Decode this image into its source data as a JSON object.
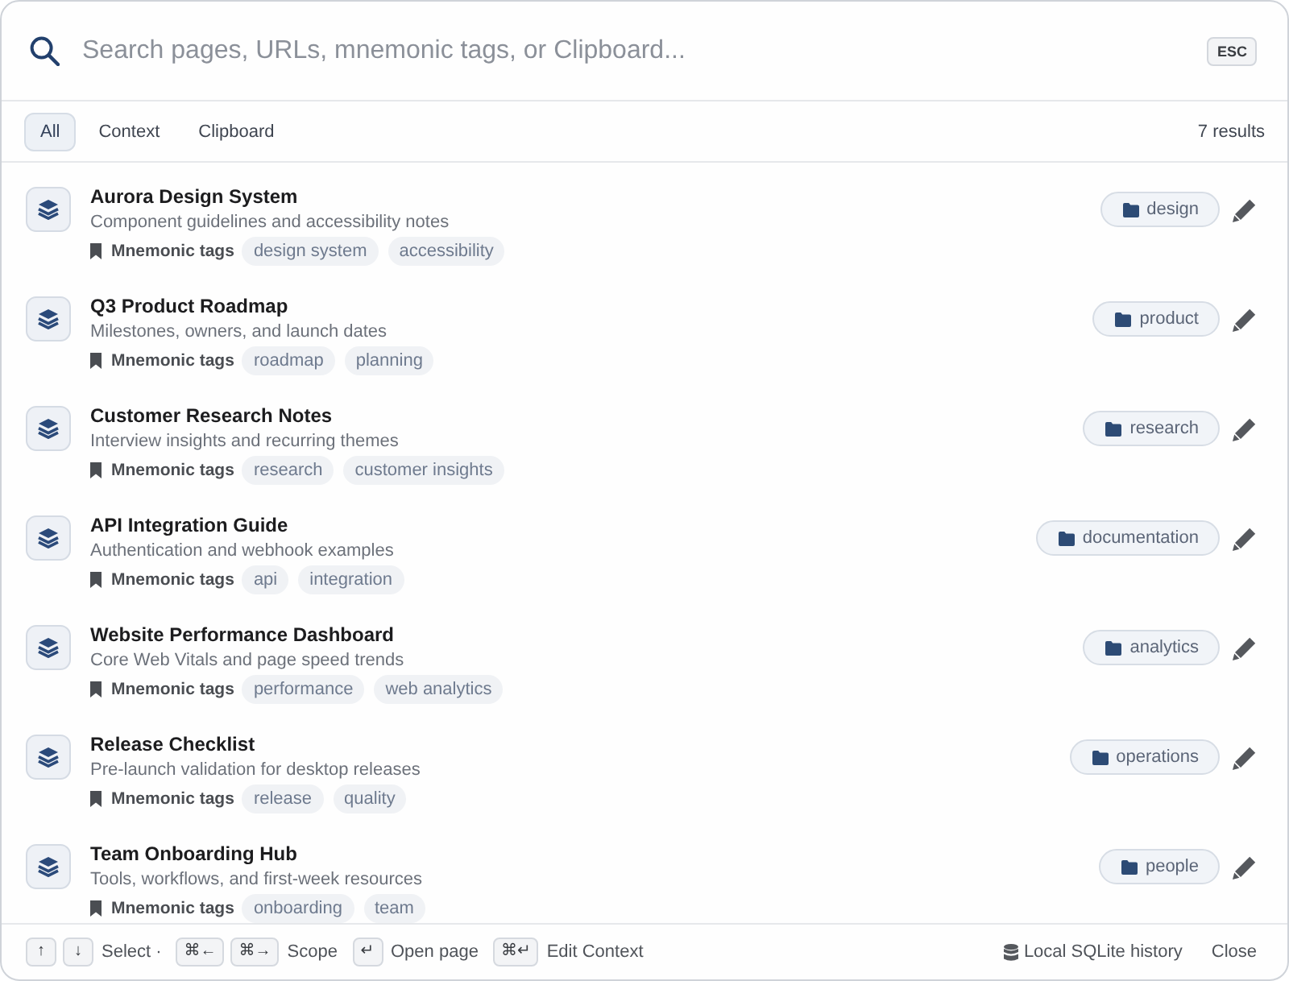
{
  "search": {
    "placeholder": "Search pages, URLs, mnemonic tags, or Clipboard...",
    "shortcut": "ESC"
  },
  "filters": [
    {
      "label": "All",
      "selected": true
    },
    {
      "label": "Context",
      "selected": false
    },
    {
      "label": "Clipboard",
      "selected": false
    }
  ],
  "result_count": "7 results",
  "results": [
    {
      "title": "Aurora Design System",
      "description": "Component guidelines and accessibility notes",
      "tags_label": "Mnemonic tags",
      "tags": [
        "design system",
        "accessibility"
      ],
      "folder": "design"
    },
    {
      "title": "Q3 Product Roadmap",
      "description": "Milestones, owners, and launch dates",
      "tags_label": "Mnemonic tags",
      "tags": [
        "roadmap",
        "planning"
      ],
      "folder": "product"
    },
    {
      "title": "Customer Research Notes",
      "description": "Interview insights and recurring themes",
      "tags_label": "Mnemonic tags",
      "tags": [
        "research",
        "customer insights"
      ],
      "folder": "research"
    },
    {
      "title": "API Integration Guide",
      "description": "Authentication and webhook examples",
      "tags_label": "Mnemonic tags",
      "tags": [
        "api",
        "integration"
      ],
      "folder": "documentation"
    },
    {
      "title": "Website Performance Dashboard",
      "description": "Core Web Vitals and page speed trends",
      "tags_label": "Mnemonic tags",
      "tags": [
        "performance",
        "web analytics"
      ],
      "folder": "analytics"
    },
    {
      "title": "Release Checklist",
      "description": "Pre-launch validation for desktop releases",
      "tags_label": "Mnemonic tags",
      "tags": [
        "release",
        "quality"
      ],
      "folder": "operations"
    },
    {
      "title": "Team Onboarding Hub",
      "description": "Tools, workflows, and first-week resources",
      "tags_label": "Mnemonic tags",
      "tags": [
        "onboarding",
        "team"
      ],
      "folder": "people"
    }
  ],
  "footer": {
    "hints": [
      {
        "keys": [
          "↑",
          "↓"
        ],
        "label": "Select ·"
      },
      {
        "keys": [
          "⌘←",
          "⌘→"
        ],
        "label": "Scope"
      },
      {
        "keys": [
          "↵"
        ],
        "label": "Open page"
      },
      {
        "keys": [
          "⌘↵"
        ],
        "label": "Edit Context"
      }
    ],
    "source": "Local SQLite history",
    "close": "Close"
  }
}
